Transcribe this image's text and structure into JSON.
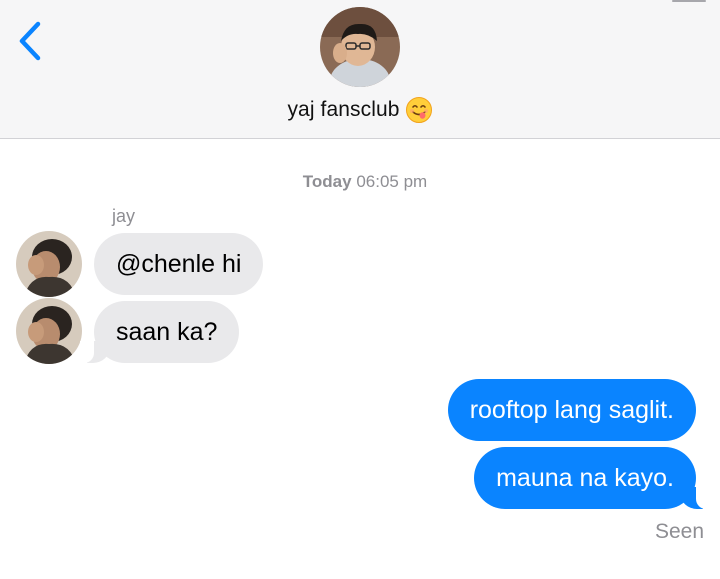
{
  "header": {
    "title": "yaj fansclub",
    "title_emoji": "smiling-face-tongue-emoji",
    "back_icon": "chevron-left-icon",
    "accent": "#0a84ff"
  },
  "thread": {
    "timestamp_day": "Today",
    "timestamp_time": "06:05 pm",
    "sender_name": "jay",
    "messages": [
      {
        "from": "them",
        "text": "@chenle hi"
      },
      {
        "from": "them",
        "text": "saan ka?"
      },
      {
        "from": "me",
        "text": "rooftop lang saglit."
      },
      {
        "from": "me",
        "text": "mauna na kayo."
      }
    ],
    "status": "Seen"
  },
  "colors": {
    "incoming_bubble": "#e9e9eb",
    "outgoing_bubble": "#0a84ff",
    "header_bg": "#f6f6f7",
    "meta_text": "#8e8e93"
  }
}
